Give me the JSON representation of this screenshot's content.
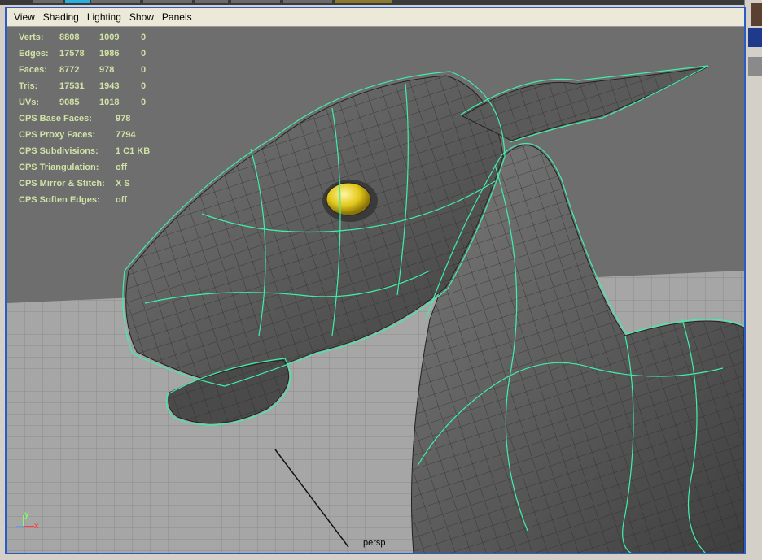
{
  "menubar": {
    "items": [
      "View",
      "Shading",
      "Lighting",
      "Show",
      "Panels"
    ]
  },
  "hud": {
    "poly_stats": [
      {
        "label": "Verts:",
        "values": [
          "8808",
          "1009",
          "0"
        ]
      },
      {
        "label": "Edges:",
        "values": [
          "17578",
          "1986",
          "0"
        ]
      },
      {
        "label": "Faces:",
        "values": [
          "8772",
          "978",
          "0"
        ]
      },
      {
        "label": "Tris:",
        "values": [
          "17531",
          "1943",
          "0"
        ]
      },
      {
        "label": "UVs:",
        "values": [
          "9085",
          "1018",
          "0"
        ]
      }
    ],
    "cps_stats": [
      {
        "label": "CPS Base Faces:",
        "value": "978"
      },
      {
        "label": "CPS Proxy Faces:",
        "value": "7794"
      },
      {
        "label": "CPS Subdivisions:",
        "value": "1 C1 KB"
      },
      {
        "label": "CPS Triangulation:",
        "value": "off"
      },
      {
        "label": "CPS Mirror & Stitch:",
        "value": "X S"
      },
      {
        "label": "CPS Soften Edges:",
        "value": "off"
      }
    ]
  },
  "viewport": {
    "camera_label": "persp",
    "axis_labels": {
      "y": "y",
      "x": "x"
    },
    "colors": {
      "background": "#6e6e6e",
      "grid_floor": "#a8a8a8",
      "grid_line": "#8c8c8c",
      "mesh_surface": "#5b5b5b",
      "cage_wire": "#3df0a8",
      "eye": "#e2c61a"
    }
  },
  "colors": {
    "panel_border": "#2a5cc8",
    "menubar_bg": "#ece9d8",
    "hud_text": "#cfe3a6"
  }
}
